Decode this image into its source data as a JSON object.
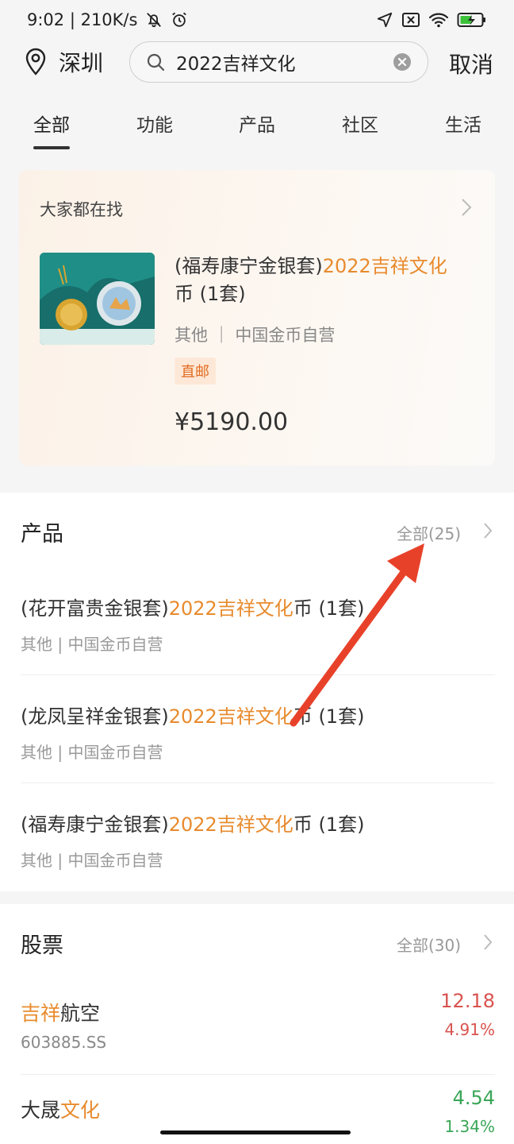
{
  "status": {
    "time_speed": "9:02 | 210K/s"
  },
  "search": {
    "city": "深圳",
    "query": "2022吉祥文化",
    "cancel_label": "取消"
  },
  "tabs": [
    {
      "label": "全部",
      "active": true
    },
    {
      "label": "功能"
    },
    {
      "label": "产品"
    },
    {
      "label": "社区"
    },
    {
      "label": "生活"
    }
  ],
  "hot": {
    "title": "大家都在找",
    "image_caption": "2022吉祥文化金银纪念币",
    "name_prefix": "(福寿康宁金银套)",
    "name_highlight": "2022吉祥文化",
    "name_suffix": "币 (1套)",
    "meta": "其他 ｜ 中国金币自营",
    "tag": "直邮",
    "price": "¥5190.00"
  },
  "products": {
    "title": "产品",
    "all_label": "全部(25)",
    "items": [
      {
        "prefix": "(花开富贵金银套)",
        "highlight": "2022吉祥文化",
        "suffix": "币 (1套)",
        "meta": "其他 | 中国金币自营"
      },
      {
        "prefix": "(龙凤呈祥金银套)",
        "highlight": "2022吉祥文化",
        "suffix": "币 (1套)",
        "meta": "其他 | 中国金币自营"
      },
      {
        "prefix": "(福寿康宁金银套)",
        "highlight": "2022吉祥文化",
        "suffix": "币 (1套)",
        "meta": "其他 | 中国金币自营"
      }
    ]
  },
  "stocks": {
    "title": "股票",
    "all_label": "全部(30)",
    "items": [
      {
        "name_highlight": "吉祥",
        "name_rest": "航空",
        "code": "603885.SS",
        "price": "12.18",
        "pct": "4.91%",
        "color": "#d9534f"
      },
      {
        "name_plain": "大晟",
        "name_highlight": "文化",
        "code": "",
        "price": "4.54",
        "pct": "1.34%",
        "color": "#3aa657"
      }
    ]
  },
  "colors": {
    "highlight": "#e88b2e",
    "arrow": "#e8412a"
  }
}
